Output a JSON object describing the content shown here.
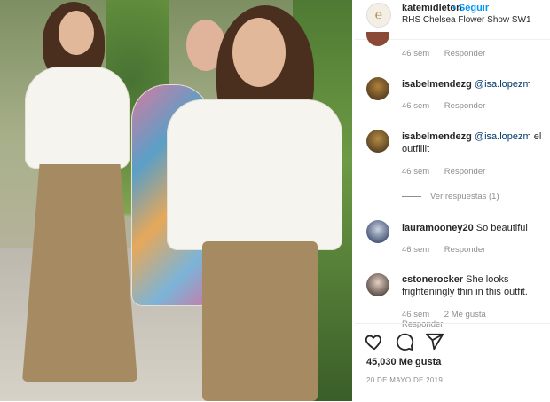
{
  "header": {
    "username": "katemidleton",
    "follow_label": "• Seguir",
    "location": "RHS Chelsea Flower Show SW1"
  },
  "comments": [
    {
      "username": "",
      "text": "",
      "time": "46 sem",
      "reply_label": "Responder",
      "avatar_color": "#8b4a36"
    },
    {
      "username": "isabelmendezg",
      "mention": "@isa.lopezm",
      "text": "",
      "time": "46 sem",
      "reply_label": "Responder",
      "avatar_color": "#5a4a2c"
    },
    {
      "username": "isabelmendezg",
      "mention": "@isa.lopezm",
      "text": "el outfiiiit",
      "time": "46 sem",
      "reply_label": "Responder",
      "avatar_color": "#6a5330",
      "view_replies": "Ver respuestas (1)"
    },
    {
      "username": "lauramooney20",
      "text": "So beautiful",
      "time": "46 sem",
      "reply_label": "Responder",
      "avatar_color": "#2c3e66"
    },
    {
      "username": "cstonerocker",
      "text": "She looks frighteningly thin in this outfit.",
      "time": "46 sem",
      "likes": "2 Me gusta",
      "reply_label": "Responder",
      "avatar_color": "#3a2e2a"
    }
  ],
  "actions": {
    "likes": "45,030 Me gusta",
    "date": "20 DE MAYO DE 2019"
  },
  "colors": {
    "link_blue": "#0095f6",
    "mention": "#00376b",
    "muted": "#8e8e8e"
  },
  "icons": [
    "heart-icon",
    "comment-icon",
    "share-icon"
  ]
}
